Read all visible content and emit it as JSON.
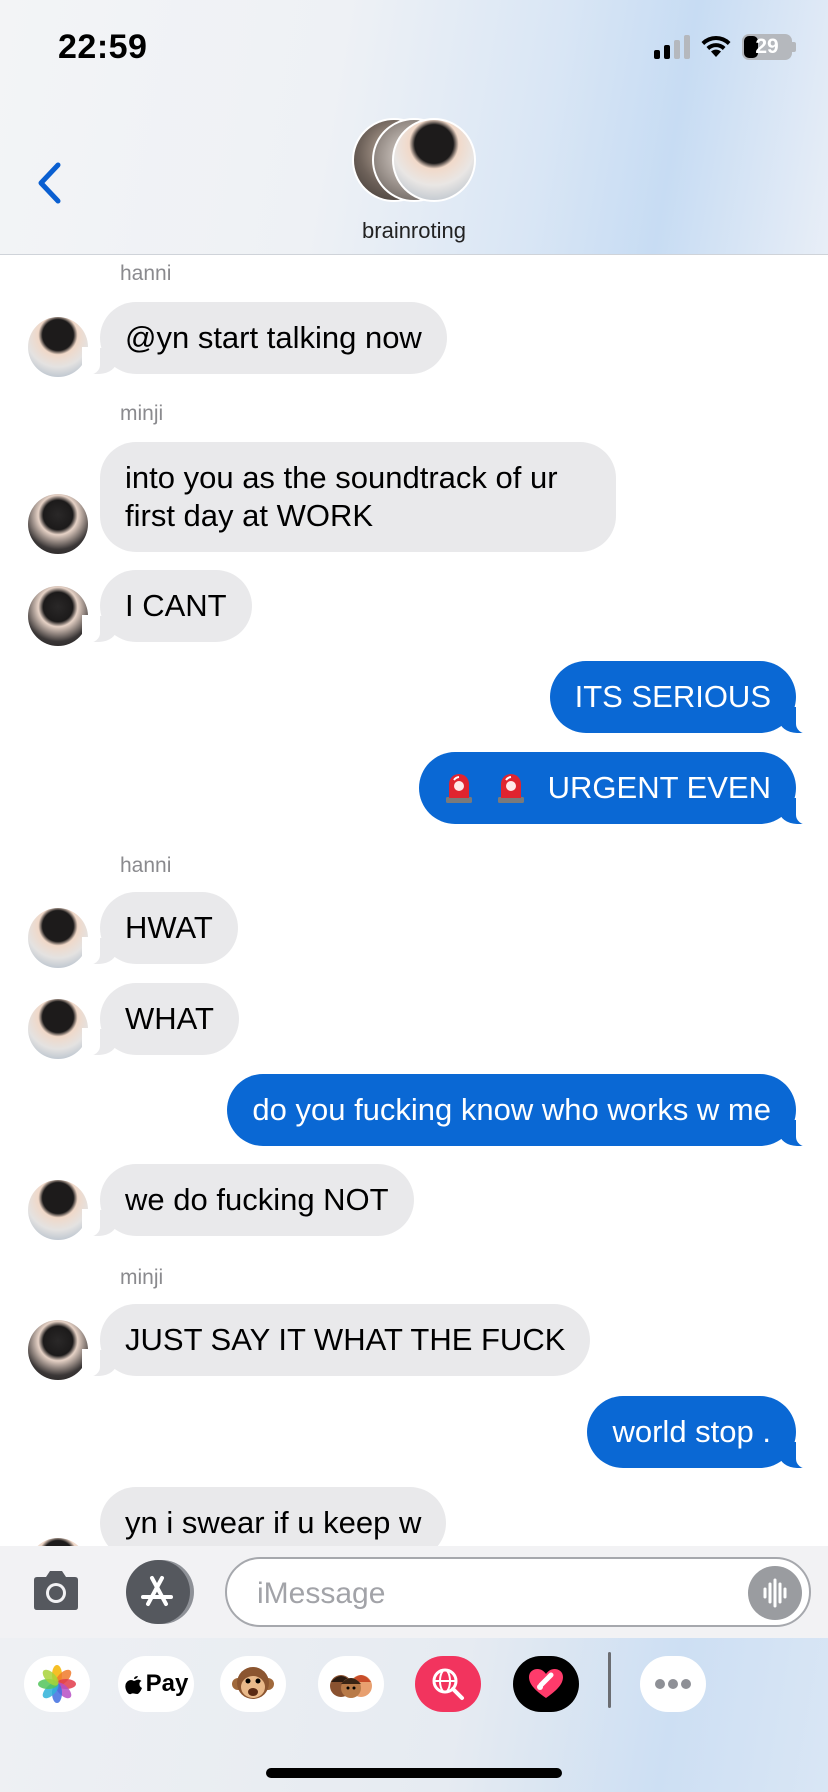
{
  "status_bar": {
    "time": "22:59",
    "battery": "29"
  },
  "header": {
    "group_name": "brainroting"
  },
  "messages": {
    "senders": {
      "hanni_1": "hanni",
      "minji_1": "minji",
      "hanni_2": "hanni",
      "minji_2": "minji"
    },
    "m1": "@yn start talking now",
    "m2_line1": "into you as the soundtrack of ur",
    "m2_line2": "first day at WORK",
    "m3": "I CANT",
    "m4": "ITS SERIOUS",
    "m5": "URGENT EVEN",
    "m6": "HWAT",
    "m7": "WHAT",
    "m8": "do you fucking know who works w me",
    "m9": "we do fucking NOT",
    "m10": "JUST SAY IT WHAT THE FUCK",
    "m11": "world stop .",
    "m12": "yn i swear if u keep w"
  },
  "input": {
    "placeholder": "iMessage"
  },
  "apps": {
    "applepay_label": "Pay"
  }
}
